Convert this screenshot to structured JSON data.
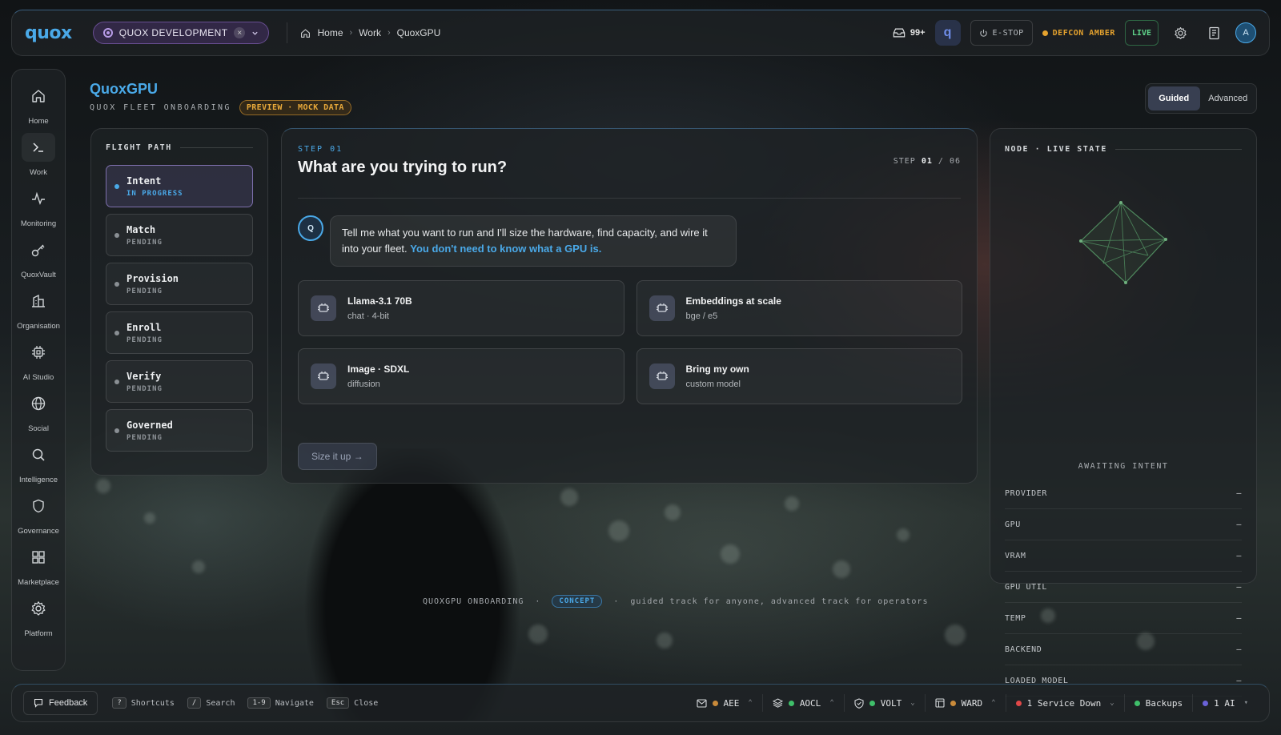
{
  "app": {
    "logo": "quox",
    "environment": "QUOX DEVELOPMENT"
  },
  "breadcrumbs": [
    "Home",
    "Work",
    "QuoxGPU"
  ],
  "topbar": {
    "inbox_count": "99+",
    "estop_label": "E-STOP",
    "defcon_label": "DEFCON AMBER",
    "live_label": "LIVE",
    "avatar_initial": "A",
    "colors": {
      "accent": "#4aa9e8",
      "defcon": "#e6a32e",
      "live": "#5fd38a",
      "env": "#b79be6"
    }
  },
  "rail": [
    {
      "label": "Home",
      "icon": "home-icon"
    },
    {
      "label": "Work",
      "icon": "terminal-icon"
    },
    {
      "label": "Monitoring",
      "icon": "pulse-icon"
    },
    {
      "label": "QuoxVault",
      "icon": "key-icon"
    },
    {
      "label": "Organisation",
      "icon": "building-icon"
    },
    {
      "label": "AI Studio",
      "icon": "chip-icon"
    },
    {
      "label": "Social",
      "icon": "globe-icon"
    },
    {
      "label": "Intelligence",
      "icon": "search-icon"
    },
    {
      "label": "Governance",
      "icon": "shield-icon"
    },
    {
      "label": "Marketplace",
      "icon": "grid-icon"
    },
    {
      "label": "Platform",
      "icon": "gear-icon"
    }
  ],
  "header": {
    "title": "QuoxGPU",
    "subtitle": "QUOX FLEET ONBOARDING",
    "tag": "PREVIEW · MOCK DATA",
    "modes": [
      "Guided",
      "Advanced"
    ],
    "active_mode": "Guided"
  },
  "flight_path": {
    "label": "FLIGHT PATH",
    "steps": [
      {
        "name": "Intent",
        "state": "IN PROGRESS"
      },
      {
        "name": "Match",
        "state": "PENDING"
      },
      {
        "name": "Provision",
        "state": "PENDING"
      },
      {
        "name": "Enroll",
        "state": "PENDING"
      },
      {
        "name": "Verify",
        "state": "PENDING"
      },
      {
        "name": "Governed",
        "state": "PENDING"
      }
    ]
  },
  "main": {
    "kicker": "STEP 01",
    "question": "What are you trying to run?",
    "counter_prefix": "STEP",
    "counter_current": "01",
    "counter_sep": "/",
    "counter_total": "06",
    "assistant_initial": "Q",
    "message": "Tell me what you want to run and I'll size the hardware, find capacity, and wire it into your fleet.",
    "message_accent": "You don't need to know what a GPU is.",
    "options": [
      {
        "title": "Llama-3.1 70B",
        "sub": "chat · 4-bit"
      },
      {
        "title": "Embeddings at scale",
        "sub": "bge / e5"
      },
      {
        "title": "Image · SDXL",
        "sub": "diffusion"
      },
      {
        "title": "Bring my own",
        "sub": "custom model"
      }
    ],
    "cta": "Size it up →"
  },
  "node": {
    "label": "NODE · LIVE STATE",
    "status": "AWAITING INTENT",
    "fields": [
      {
        "key": "PROVIDER",
        "value": "—"
      },
      {
        "key": "GPU",
        "value": "—"
      },
      {
        "key": "VRAM",
        "value": "—"
      },
      {
        "key": "GPU UTIL",
        "value": "—"
      },
      {
        "key": "TEMP",
        "value": "—"
      },
      {
        "key": "BACKEND",
        "value": "—"
      },
      {
        "key": "LOADED MODEL",
        "value": "—"
      }
    ]
  },
  "caption": {
    "left": "QUOXGPU ONBOARDING",
    "tag": "CONCEPT",
    "right": "guided track for anyone, advanced track for operators"
  },
  "bottombar": {
    "feedback": "Feedback",
    "hotkeys": [
      {
        "key": "?",
        "label": "Shortcuts"
      },
      {
        "key": "/",
        "label": "Search"
      },
      {
        "key": "1-9",
        "label": "Navigate"
      },
      {
        "key": "Esc",
        "label": "Close"
      }
    ],
    "status": [
      {
        "label": "AEE",
        "dot": "#c98a3a",
        "icon": "mail-icon"
      },
      {
        "label": "AOCL",
        "dot": "#3fbf6a",
        "icon": "layers-icon"
      },
      {
        "label": "VOLT",
        "dot": "#3fbf6a",
        "icon": "shield-check-icon"
      },
      {
        "label": "WARD",
        "dot": "#c98a3a",
        "icon": "panel-icon"
      },
      {
        "label": "1 Service Down",
        "dot": "#e04848",
        "icon": ""
      },
      {
        "label": "Backups",
        "dot": "#3fbf6a",
        "icon": ""
      },
      {
        "label": "1 AI",
        "dot": "#6a62d8",
        "icon": ""
      }
    ]
  }
}
